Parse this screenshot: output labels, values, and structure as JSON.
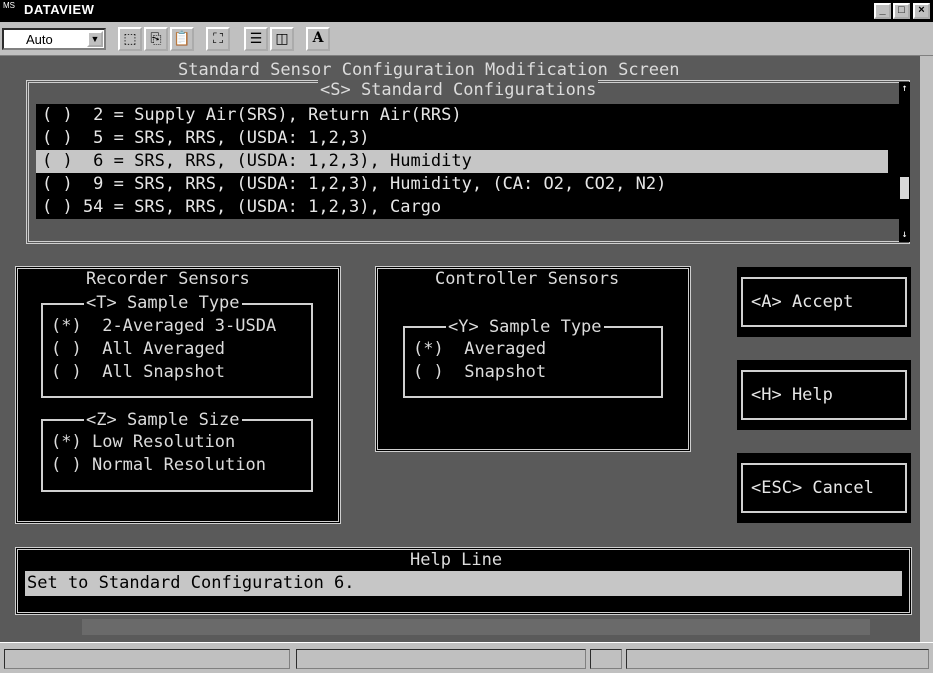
{
  "window": {
    "title": "DATAVIEW",
    "icon_label": "MS",
    "buttons": {
      "minimize": "_",
      "maximize": "□",
      "close": "×"
    }
  },
  "toolbar": {
    "font_select_value": "Auto",
    "font_select_arrow": "▼",
    "buttons": [
      {
        "name": "mark-icon",
        "glyph": "⬚"
      },
      {
        "name": "copy-icon",
        "glyph": "⎘"
      },
      {
        "name": "paste-icon",
        "glyph": "📋"
      },
      {
        "name": "fullscreen-icon",
        "glyph": "⛶"
      },
      {
        "name": "properties-icon",
        "glyph": "☰"
      },
      {
        "name": "background-icon",
        "glyph": "◫"
      },
      {
        "name": "font-icon",
        "glyph": "A"
      }
    ]
  },
  "screen": {
    "title": "Standard Sensor Configuration Modification Screen",
    "config_legend": "<S> Standard Configurations",
    "configs": [
      {
        "text": "( )  2 = Supply Air(SRS), Return Air(RRS)",
        "selected": false
      },
      {
        "text": "( )  5 = SRS, RRS, (USDA: 1,2,3)",
        "selected": false
      },
      {
        "text": "( )  6 = SRS, RRS, (USDA: 1,2,3), Humidity",
        "selected": true
      },
      {
        "text": "( )  9 = SRS, RRS, (USDA: 1,2,3), Humidity, (CA: O2, CO2, N2)",
        "selected": false
      },
      {
        "text": "( ) 54 = SRS, RRS, (USDA: 1,2,3), Cargo",
        "selected": false
      }
    ],
    "scroll_up": "↑",
    "scroll_down": "↓",
    "recorder": {
      "legend": "Recorder Sensors",
      "type_legend": "<T> Sample Type",
      "type_options": [
        {
          "mark": "(*)",
          "label": "2-Averaged 3-USDA"
        },
        {
          "mark": "( )",
          "label": "All Averaged"
        },
        {
          "mark": "( )",
          "label": "All Snapshot"
        }
      ],
      "size_legend": "<Z> Sample Size",
      "size_options": [
        {
          "mark": "(*)",
          "label": "Low Resolution"
        },
        {
          "mark": "( )",
          "label": "Normal Resolution"
        }
      ]
    },
    "controller": {
      "legend": "Controller Sensors",
      "type_legend": "<Y> Sample Type",
      "type_options": [
        {
          "mark": "(*)",
          "label": "Averaged"
        },
        {
          "mark": "( )",
          "label": "Snapshot"
        }
      ]
    },
    "actions": {
      "accept": "<A> Accept",
      "help": "<H> Help",
      "cancel": "<ESC> Cancel"
    },
    "help_line": {
      "legend": "Help Line",
      "text": "Set to Standard Configuration 6."
    }
  }
}
